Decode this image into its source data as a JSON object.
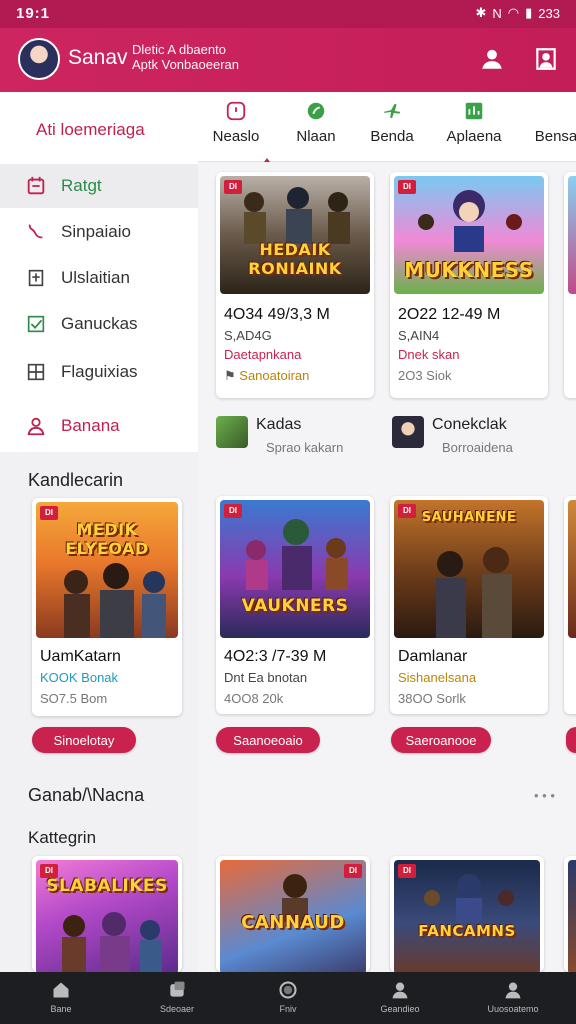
{
  "status_bar": {
    "time": "19:1",
    "battery": "233"
  },
  "header": {
    "title": "Sanav",
    "subtitle_line1": "Dletic A dbaento",
    "subtitle_line2": "Aptk Vonbaoeeran"
  },
  "sidebar": {
    "heading": "Ati loemeriaga",
    "items": [
      {
        "label": "Ratgt"
      },
      {
        "label": "Sinpaiaio"
      },
      {
        "label": "Ulslaitian"
      },
      {
        "label": "Ganuckas"
      },
      {
        "label": "Flaguixias"
      },
      {
        "label": "Banana"
      }
    ]
  },
  "tabs": [
    {
      "label": "Neaslo"
    },
    {
      "label": "Nlaan"
    },
    {
      "label": "Benda"
    },
    {
      "label": "Aplaena"
    },
    {
      "label": "Bensa"
    }
  ],
  "sections": {
    "featured_left": "Kandlecarin",
    "genre": "Ganab/\\Nacna",
    "categories": "Kattegrin",
    "more": "• • •"
  },
  "cards": {
    "row1": [
      {
        "art_title": "HEDAIK RONIAINK",
        "line1": "4O34 49/3,3 M",
        "line2": "S,AD4G",
        "line3": "Daetapnkana",
        "line4": "Sanoatoiran",
        "badge": "DI"
      },
      {
        "art_title": "MUKKNESS",
        "line1": "2O22 12-49 M",
        "line2": "S,AIN4",
        "line3": "Dnek skan",
        "line4": "2O3 Siok",
        "badge": "DI"
      }
    ],
    "left_card": {
      "art_title": "MEDIK ELYEOAD",
      "line1": "UamKatarn",
      "line2": "KOOK Bonak",
      "line3": "SO7.5 Bom",
      "button": "Sinoelotay",
      "badge": "DI"
    },
    "row2": [
      {
        "art_title": "VAUKNERS",
        "line1": "4O2:3 /7-39 M",
        "line2": "Dnt Ea bnotan",
        "line3": "4OO8 20k",
        "button": "Saanoeoaio",
        "badge": "DI"
      },
      {
        "art_title": "SAUHANENE",
        "line1": "Damlanar",
        "line2": "Sishanelsana",
        "line3": "38OO Sorlk",
        "button": "Saeroanooe",
        "badge": "DI"
      }
    ],
    "row3": [
      {
        "art_title": "SLABALIKES",
        "badge": "DI"
      },
      {
        "art_title": "CANNAUD",
        "badge": "DI"
      },
      {
        "art_title": "FANCAMNS",
        "badge": "DI"
      }
    ]
  },
  "developers": [
    {
      "name": "Kadas",
      "sub": "Sprao kakarn"
    },
    {
      "name": "Conekclak",
      "sub": "Borroaidena"
    }
  ],
  "bottom_nav": [
    {
      "label": "Bane"
    },
    {
      "label": "Sdeoaer"
    },
    {
      "label": "Fniv"
    },
    {
      "label": "Geandieo"
    },
    {
      "label": "Uuosoatemo"
    }
  ],
  "colors": {
    "brand": "#c9224f",
    "header": "#cc2560",
    "nav": "#1d1e22"
  }
}
